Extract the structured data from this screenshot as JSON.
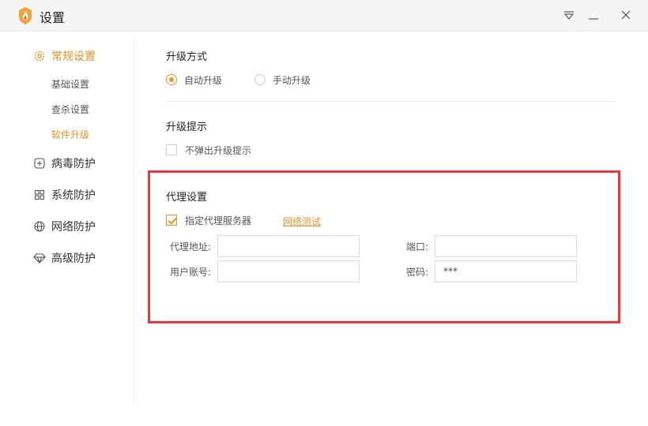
{
  "window": {
    "title": "设置"
  },
  "sidebar": {
    "groups": [
      {
        "label": "常规设置",
        "icon": "gear-icon",
        "active": true,
        "children": [
          {
            "label": "基础设置",
            "active": false
          },
          {
            "label": "查杀设置",
            "active": false
          },
          {
            "label": "软件升级",
            "active": true
          }
        ]
      },
      {
        "label": "病毒防护",
        "icon": "plus-square-icon"
      },
      {
        "label": "系统防护",
        "icon": "windows-grid-icon"
      },
      {
        "label": "网络防护",
        "icon": "globe-icon"
      },
      {
        "label": "高级防护",
        "icon": "diamond-icon"
      }
    ]
  },
  "upgrade_method": {
    "title": "升级方式",
    "options": [
      {
        "label": "自动升级",
        "selected": true
      },
      {
        "label": "手动升级",
        "selected": false
      }
    ]
  },
  "upgrade_notice": {
    "title": "升级提示",
    "checkbox": {
      "label": "不弹出升级提示",
      "checked": false
    }
  },
  "proxy": {
    "title": "代理设置",
    "enable": {
      "label": "指定代理服务器",
      "checked": true
    },
    "test_link": "网络测试",
    "address": {
      "label": "代理地址:",
      "value": ""
    },
    "port": {
      "label": "端口:",
      "value": ""
    },
    "username": {
      "label": "用户账号:",
      "value": ""
    },
    "password": {
      "label": "密码:",
      "value": "***"
    }
  },
  "colors": {
    "accent": "#e8932a",
    "highlight": "#e8383d"
  }
}
